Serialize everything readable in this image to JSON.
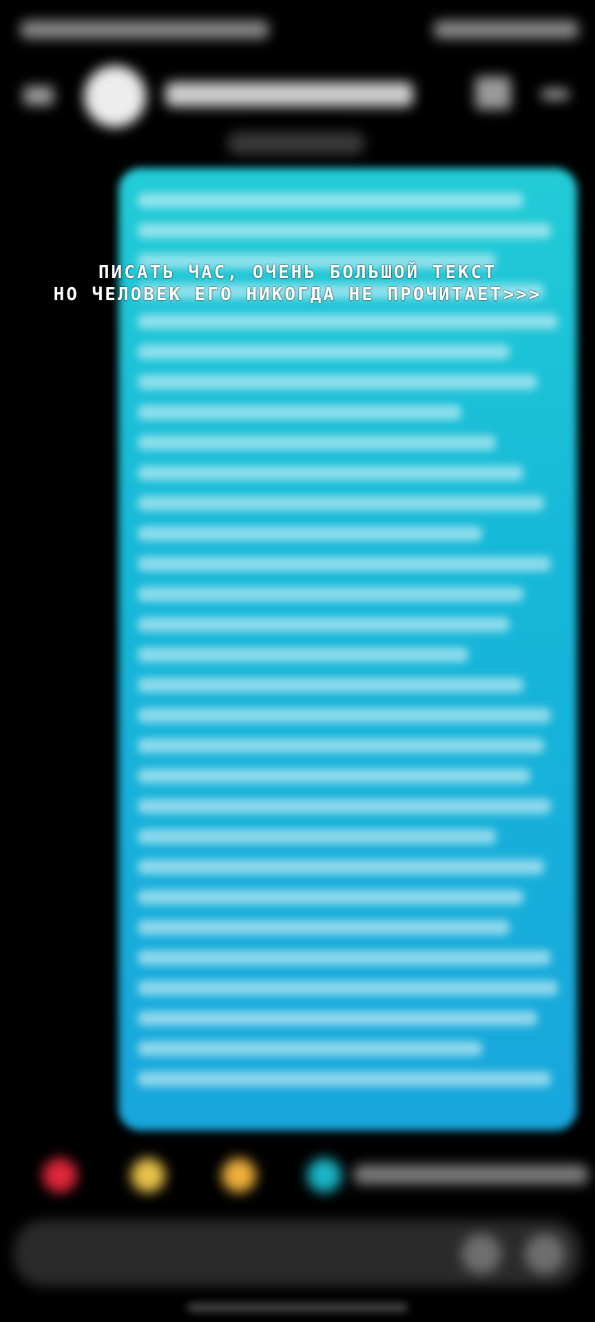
{
  "overlay": {
    "line1": "ПИСАТЬ ЧАС, ОЧЕНЬ БОЛЬШОЙ ТЕКСТ",
    "line2": "НО ЧЕЛОВЕК ЕГО НИКОГДА НЕ ПРОЧИТАЕТ>>>"
  },
  "input": {
    "placeholder": ""
  },
  "colors": {
    "background": "#000000",
    "bubble_top": "#22ccd6",
    "bubble_bottom": "#18a6dc",
    "reaction_red": "#e0263a",
    "reaction_yellow": "#e8c24a",
    "reaction_orange": "#f0b03a",
    "reaction_teal": "#1ab6c6"
  },
  "icons": [
    "back-arrow-icon",
    "avatar",
    "video-call-icon",
    "more-icon",
    "emoji-icon",
    "send-icon"
  ]
}
